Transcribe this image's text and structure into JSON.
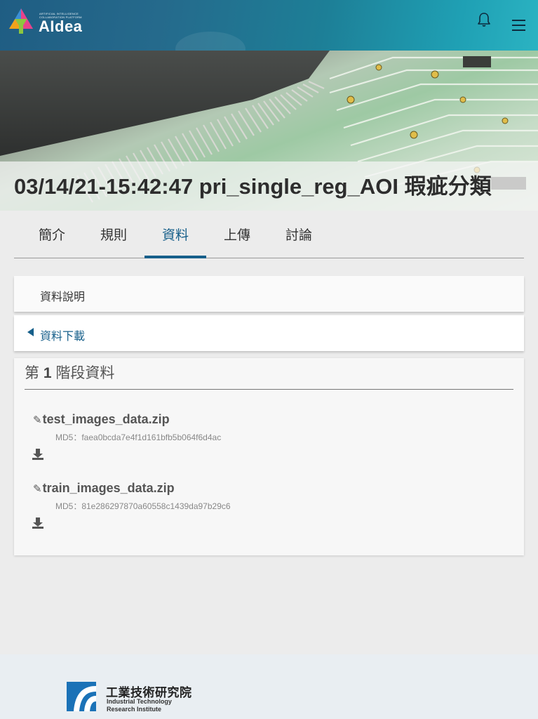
{
  "header": {
    "logo_small_text_1": "ARTIFICIAL INTELLIGENCE",
    "logo_small_text_2": "COLLABORATION PLATFORM",
    "logo_word": "AIdea"
  },
  "banner": {
    "title_bold": "03/14/21-15:42:47 pri_single_reg_AOI",
    "title_rest": " 瑕疵分類"
  },
  "tabs": [
    {
      "label": "簡介"
    },
    {
      "label": "規則"
    },
    {
      "label": "資料",
      "active": true
    },
    {
      "label": "上傳"
    },
    {
      "label": "討論"
    }
  ],
  "sections": {
    "data_description": "資料說明",
    "data_download": "資料下載"
  },
  "stage": {
    "prefix": "第",
    "number": "1",
    "suffix": "階段資料"
  },
  "files": [
    {
      "name": "test_images_data.zip",
      "md5": "MD5：faea0bcda7e4f1d161bfb5b064f6d4ac"
    },
    {
      "name": "train_images_data.zip",
      "md5": "MD5：81e286297870a60558c1439da97b29c6"
    }
  ],
  "footer": {
    "org_name_cn": "工業技術研究院",
    "org_name_en_1": "Industrial Technology",
    "org_name_en_2": "Research Institute"
  },
  "colors": {
    "accent": "#165f8a",
    "footer_logo": "#1b72b7"
  }
}
